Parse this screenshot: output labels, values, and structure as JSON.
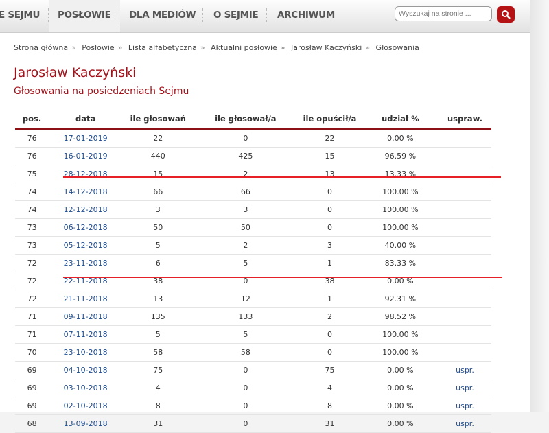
{
  "nav": {
    "items": [
      "E SEJMU",
      "POSŁOWIE",
      "DLA MEDIÓW",
      "O SEJMIE",
      "ARCHIWUM"
    ],
    "active": "POSŁOWIE"
  },
  "search": {
    "placeholder": "Wyszukaj na stronie ...",
    "icon": "search-icon"
  },
  "breadcrumb": [
    "Strona główna",
    "Posłowie",
    "Lista alfabetyczna",
    "Aktualni posłowie",
    "Jarosław Kaczyński",
    "Głosowania"
  ],
  "breadcrumb_separator": "»",
  "title": "Jarosław Kaczyński",
  "subtitle": "Głosowania na posiedzeniach Sejmu",
  "table": {
    "headers": [
      "pos.",
      "data",
      "ile głosowań",
      "ile głosował/a",
      "ile opuścił/a",
      "udział %",
      "uspraw."
    ],
    "rows": [
      [
        "76",
        "17-01-2019",
        "22",
        "0",
        "22",
        "0.00 %",
        ""
      ],
      [
        "76",
        "16-01-2019",
        "440",
        "425",
        "15",
        "96.59 %",
        ""
      ],
      [
        "75",
        "28-12-2018",
        "15",
        "2",
        "13",
        "13.33 %",
        ""
      ],
      [
        "74",
        "14-12-2018",
        "66",
        "66",
        "0",
        "100.00 %",
        ""
      ],
      [
        "74",
        "12-12-2018",
        "3",
        "3",
        "0",
        "100.00 %",
        ""
      ],
      [
        "73",
        "06-12-2018",
        "50",
        "50",
        "0",
        "100.00 %",
        ""
      ],
      [
        "73",
        "05-12-2018",
        "5",
        "2",
        "3",
        "40.00 %",
        ""
      ],
      [
        "72",
        "23-11-2018",
        "6",
        "5",
        "1",
        "83.33 %",
        ""
      ],
      [
        "72",
        "22-11-2018",
        "38",
        "0",
        "38",
        "0.00 %",
        ""
      ],
      [
        "72",
        "21-11-2018",
        "13",
        "12",
        "1",
        "92.31 %",
        ""
      ],
      [
        "71",
        "09-11-2018",
        "135",
        "133",
        "2",
        "98.52 %",
        ""
      ],
      [
        "71",
        "07-11-2018",
        "5",
        "5",
        "0",
        "100.00 %",
        ""
      ],
      [
        "70",
        "23-10-2018",
        "58",
        "58",
        "0",
        "100.00 %",
        ""
      ],
      [
        "69",
        "04-10-2018",
        "75",
        "0",
        "75",
        "0.00 %",
        "uspr."
      ],
      [
        "69",
        "03-10-2018",
        "4",
        "0",
        "4",
        "0.00 %",
        "uspr."
      ],
      [
        "69",
        "02-10-2018",
        "8",
        "0",
        "8",
        "0.00 %",
        "uspr."
      ],
      [
        "68",
        "13-09-2018",
        "31",
        "0",
        "31",
        "0.00 %",
        "uspr."
      ]
    ]
  },
  "colors": {
    "accent": "#a3111a",
    "link": "#1f4b8c",
    "annotation_line": "#e52127"
  }
}
